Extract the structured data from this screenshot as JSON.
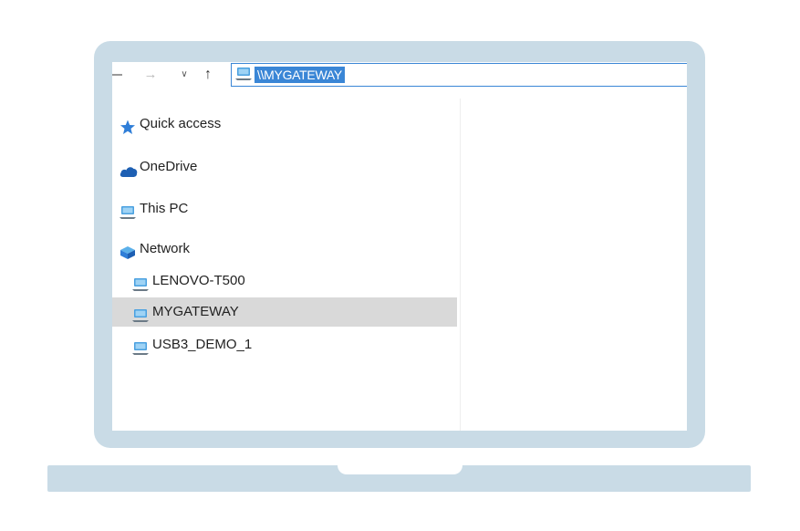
{
  "explorer": {
    "address": {
      "path": "\\\\MYGATEWAY",
      "icon": "computer-icon"
    },
    "nav_buttons": {
      "back": "back-arrow-icon",
      "forward": "forward-arrow-icon",
      "recent": "chevron-down-icon",
      "up": "up-arrow-icon"
    },
    "sidebar": {
      "items": [
        {
          "label": "Quick access",
          "icon": "star-icon"
        },
        {
          "label": "OneDrive",
          "icon": "cloud-icon"
        },
        {
          "label": "This PC",
          "icon": "computer-icon"
        },
        {
          "label": "Network",
          "icon": "network-icon"
        },
        {
          "label": "LENOVO-T500",
          "icon": "computer-icon"
        },
        {
          "label": "MYGATEWAY",
          "icon": "computer-icon",
          "selected": true
        },
        {
          "label": "USB3_DEMO_1",
          "icon": "computer-icon"
        }
      ]
    }
  },
  "colors": {
    "frame": "#c9dbe6",
    "selection": "#d9d9d9",
    "address_highlight": "#3a86d6"
  }
}
